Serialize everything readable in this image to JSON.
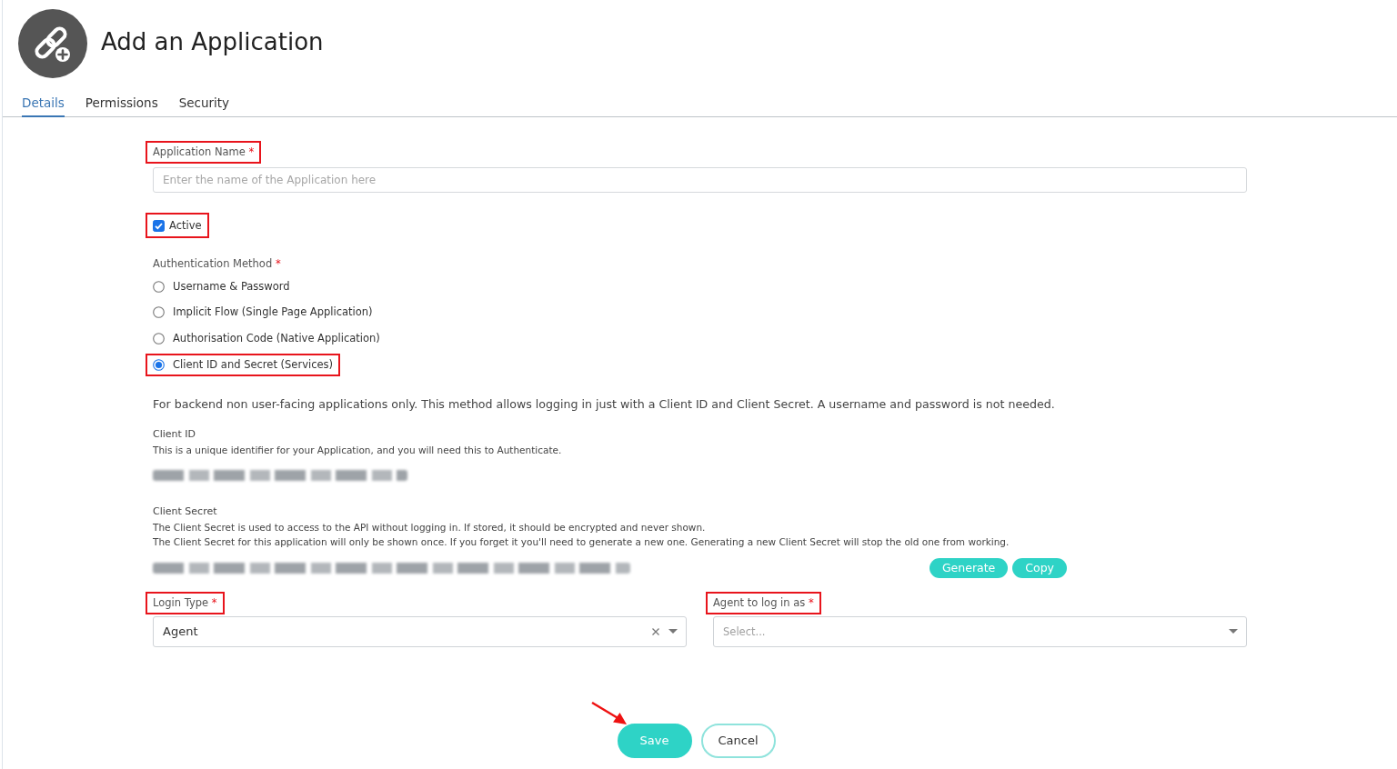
{
  "header": {
    "title": "Add an Application"
  },
  "tabs": [
    {
      "label": "Details",
      "selected": true
    },
    {
      "label": "Permissions",
      "selected": false
    },
    {
      "label": "Security",
      "selected": false
    }
  ],
  "application_name": {
    "label": "Application Name",
    "required_mark": "*",
    "placeholder": "Enter the name of the Application here",
    "highlighted": true
  },
  "active": {
    "label": "Active",
    "checked": true,
    "highlighted": true
  },
  "authentication_method": {
    "label": "Authentication Method",
    "required_mark": "*",
    "options": [
      {
        "label": "Username & Password",
        "selected": false,
        "highlighted": false
      },
      {
        "label": "Implicit Flow (Single Page Application)",
        "selected": false,
        "highlighted": false
      },
      {
        "label": "Authorisation Code (Native Application)",
        "selected": false,
        "highlighted": false
      },
      {
        "label": "Client ID and Secret (Services)",
        "selected": true,
        "highlighted": true
      }
    ],
    "description": "For backend non user-facing applications only. This method allows logging in just with a Client ID and Client Secret. A username and password is not needed."
  },
  "client_id": {
    "label": "Client ID",
    "hints": [
      "This is a unique identifier for your Application, and you will need this to Authenticate."
    ],
    "redacted": true
  },
  "client_secret": {
    "label": "Client Secret",
    "hints": [
      "The Client Secret is used to access to the API without logging in. If stored, it should be encrypted and never shown.",
      "The Client Secret for this application will only be shown once. If you forget it you'll need to generate a new one. Generating a new Client Secret will stop the old one from working."
    ],
    "redacted": true,
    "buttons": [
      "Generate",
      "Copy"
    ]
  },
  "login_type": {
    "label": "Login Type",
    "required_mark": "*",
    "value": "Agent",
    "highlighted": true
  },
  "agent": {
    "label": "Agent to log in as",
    "required_mark": "*",
    "placeholder": "Select...",
    "highlighted": true
  },
  "actions": [
    {
      "label": "Save",
      "kind": "primary",
      "pointed_at": true
    },
    {
      "label": "Cancel",
      "kind": "secondary",
      "pointed_at": false
    }
  ]
}
